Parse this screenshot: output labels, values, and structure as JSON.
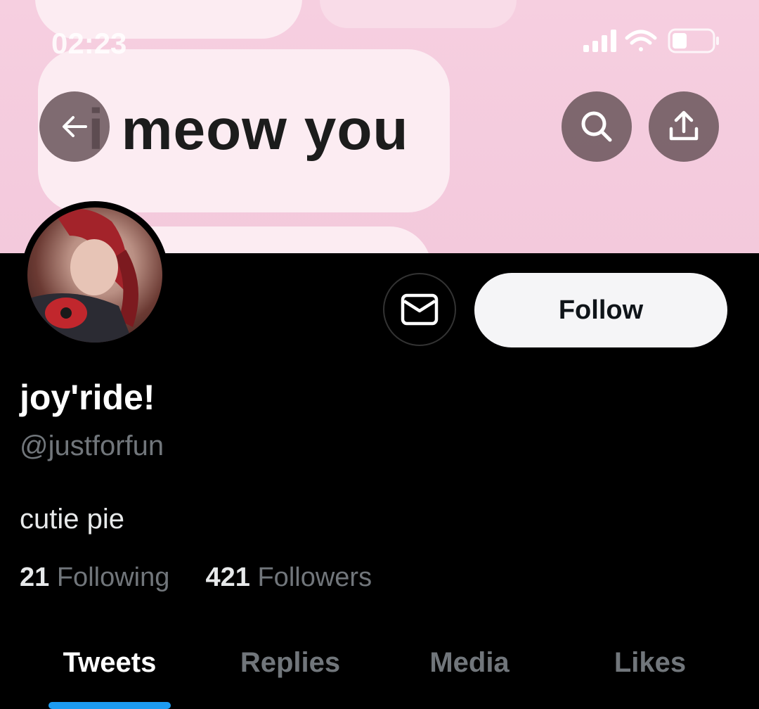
{
  "status_bar": {
    "time": "02:23"
  },
  "banner": {
    "text": "i meow you"
  },
  "header_actions": {
    "back": "back-arrow-icon",
    "search": "search-icon",
    "share": "share-icon"
  },
  "profile": {
    "name": "joy'ride!",
    "handle": "@justforfun",
    "bio": "cutie pie",
    "following_count": "21",
    "following_label": "Following",
    "followers_count": "421",
    "followers_label": "Followers",
    "follow_label": "Follow"
  },
  "tabs": [
    {
      "label": "Tweets",
      "active": true
    },
    {
      "label": "Replies",
      "active": false
    },
    {
      "label": "Media",
      "active": false
    },
    {
      "label": "Likes",
      "active": false
    }
  ],
  "colors": {
    "accent": "#1d9bf0",
    "muted": "#71767b",
    "banner": "#f6cfe0"
  }
}
